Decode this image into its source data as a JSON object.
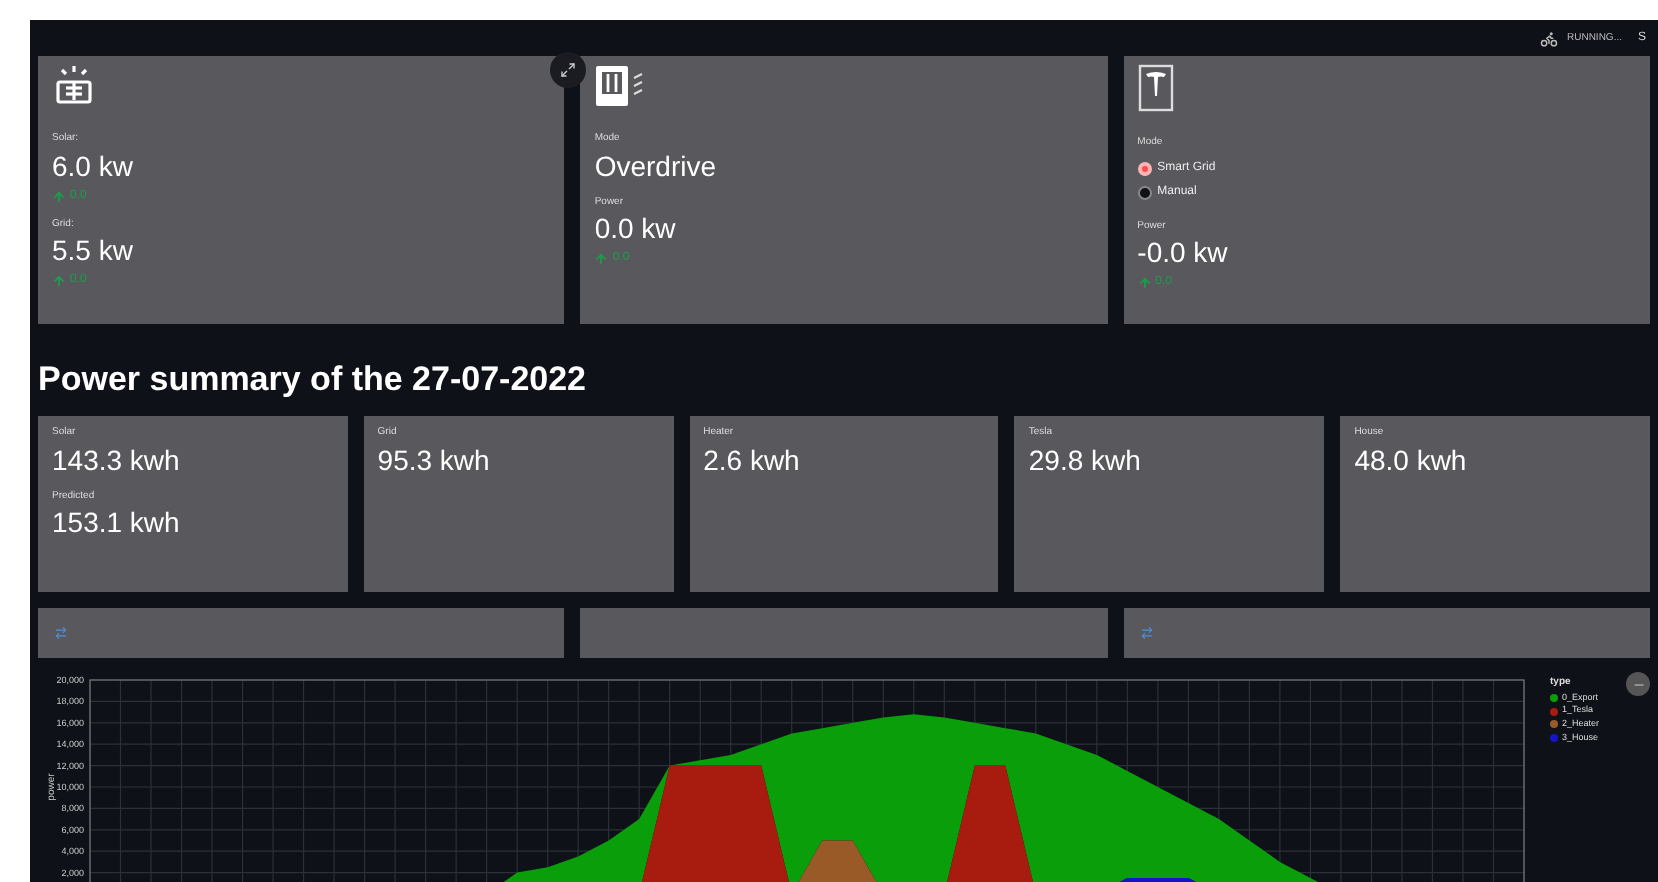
{
  "header": {
    "status": "RUNNING...",
    "button": "S"
  },
  "devices": [
    {
      "kind": "solar",
      "readings": [
        {
          "label": "Solar:",
          "value": "6.0 kw",
          "delta": "0.0"
        },
        {
          "label": "Grid:",
          "value": "5.5 kw",
          "delta": "0.0"
        }
      ]
    },
    {
      "kind": "heater",
      "readings": [
        {
          "label": "Mode",
          "value": "Overdrive"
        },
        {
          "label": "Power",
          "value": "0.0 kw",
          "delta": "0.0"
        }
      ]
    },
    {
      "kind": "tesla",
      "mode": {
        "label": "Mode",
        "options": [
          {
            "label": "Smart Grid",
            "selected": true
          },
          {
            "label": "Manual",
            "selected": false
          }
        ]
      },
      "readings": [
        {
          "label": "Power",
          "value": "-0.0 kw",
          "delta": "0.0"
        }
      ]
    }
  ],
  "summary": {
    "title": "Power summary of the 27-07-2022",
    "cards": [
      {
        "items": [
          {
            "label": "Solar",
            "value": "143.3 kwh"
          },
          {
            "label": "Predicted",
            "value": "153.1 kwh"
          }
        ]
      },
      {
        "items": [
          {
            "label": "Grid",
            "value": "95.3 kwh"
          }
        ]
      },
      {
        "items": [
          {
            "label": "Heater",
            "value": "2.6 kwh"
          }
        ]
      },
      {
        "items": [
          {
            "label": "Tesla",
            "value": "29.8 kwh"
          }
        ]
      },
      {
        "items": [
          {
            "label": "House",
            "value": "48.0 kwh"
          }
        ]
      }
    ]
  },
  "panels": [
    {
      "icon": true
    },
    {
      "icon": false
    },
    {
      "icon": true
    }
  ],
  "chart": {
    "legend_title": "type",
    "chart_data": {
      "type": "area",
      "stacked": true,
      "grid": true,
      "ylabel": "power",
      "ylim": [
        0,
        20000
      ],
      "yticks": [
        {
          "value": 2000,
          "label": "2,000"
        },
        {
          "value": 4000,
          "label": "4,000"
        },
        {
          "value": 6000,
          "label": "6,000"
        },
        {
          "value": 8000,
          "label": "8,000"
        },
        {
          "value": 10000,
          "label": "10,000"
        },
        {
          "value": 12000,
          "label": "12,000"
        },
        {
          "value": 14000,
          "label": "14,000"
        },
        {
          "value": 16000,
          "label": "16,000"
        },
        {
          "value": 18000,
          "label": "18,000"
        },
        {
          "value": 20000,
          "label": "20,000"
        }
      ],
      "series": [
        {
          "name": "0_Export",
          "color": "#0a9e0a",
          "values": [
            0,
            0,
            0,
            0,
            0,
            0,
            0,
            0,
            0,
            0,
            0,
            0,
            0,
            0,
            2000,
            2500,
            3500,
            5000,
            7000,
            0,
            500,
            1000,
            2000,
            15000,
            10500,
            11000,
            16500,
            16800,
            16500,
            4000,
            3500,
            15000,
            14000,
            13000,
            10000,
            8500,
            7000,
            7000,
            5000,
            3000,
            1500,
            0,
            0,
            0,
            0,
            0,
            0,
            0
          ]
        },
        {
          "name": "1_Tesla",
          "color": "#a81c10",
          "values": [
            0,
            0,
            0,
            0,
            0,
            0,
            0,
            0,
            0,
            0,
            0,
            0,
            0,
            0,
            0,
            0,
            0,
            0,
            0,
            12000,
            12000,
            12000,
            12000,
            0,
            0,
            0,
            0,
            0,
            0,
            12000,
            12000,
            0,
            0,
            0,
            0,
            0,
            0,
            0,
            0,
            0,
            0,
            0,
            0,
            0,
            0,
            0,
            0,
            0
          ]
        },
        {
          "name": "2_Heater",
          "color": "#9a5a28",
          "values": [
            0,
            0,
            0,
            0,
            0,
            0,
            0,
            0,
            0,
            0,
            0,
            0,
            0,
            0,
            0,
            0,
            0,
            0,
            0,
            0,
            0,
            0,
            0,
            0,
            5000,
            5000,
            0,
            0,
            0,
            0,
            0,
            0,
            0,
            0,
            0,
            0,
            0,
            0,
            0,
            0,
            0,
            0,
            0,
            0,
            0,
            0,
            0,
            0
          ]
        },
        {
          "name": "3_House",
          "color": "#1414c8",
          "values": [
            0,
            0,
            0,
            0,
            0,
            0,
            0,
            0,
            0,
            0,
            0,
            0,
            0,
            0,
            0,
            0,
            0,
            0,
            0,
            0,
            0,
            0,
            0,
            0,
            0,
            0,
            0,
            0,
            0,
            0,
            0,
            0,
            0,
            0,
            1500,
            1500,
            1500,
            0,
            0,
            0,
            0,
            0,
            0,
            0,
            0,
            1000,
            0,
            0
          ]
        }
      ]
    }
  }
}
